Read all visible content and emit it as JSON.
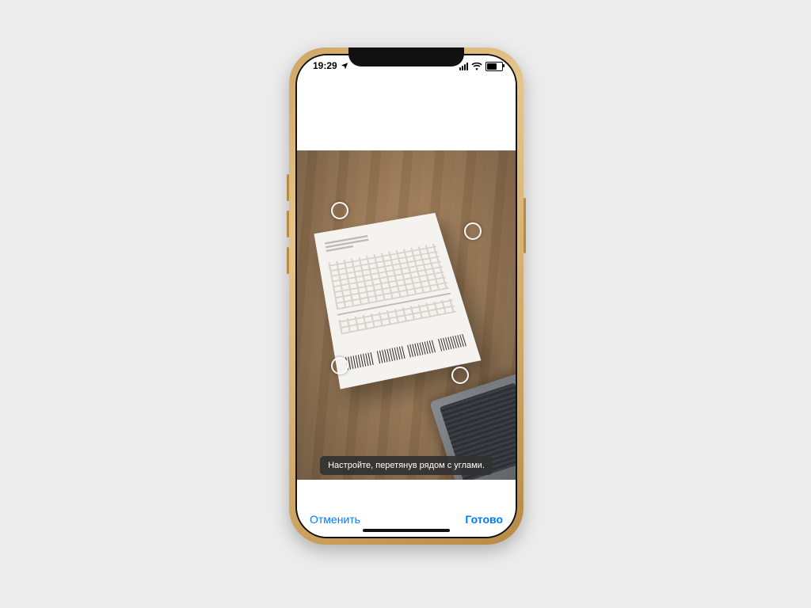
{
  "status_bar": {
    "time": "19:29",
    "location_icon": "location-arrow-icon",
    "signal_icon": "cellular-signal-icon",
    "wifi_icon": "wifi-icon",
    "battery_icon": "battery-icon"
  },
  "scanner": {
    "instruction": "Настройте, перетянув рядом с углами."
  },
  "toolbar": {
    "cancel_label": "Отменить",
    "done_label": "Готово"
  },
  "colors": {
    "ios_blue": "#007aff"
  }
}
